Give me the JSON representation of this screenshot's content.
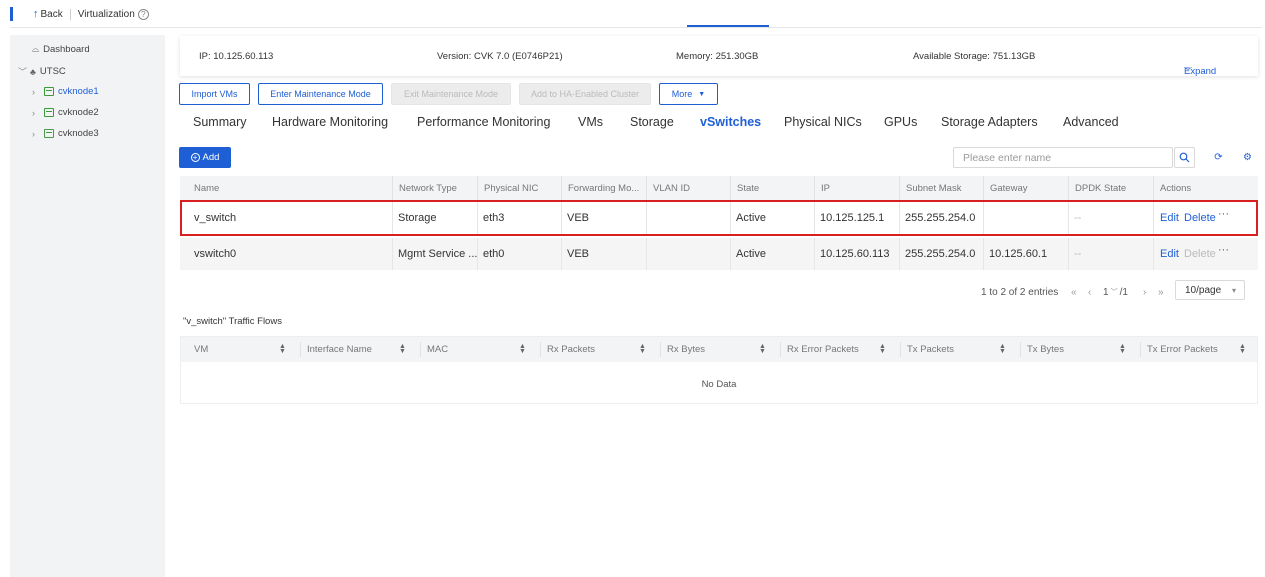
{
  "topbar": {
    "back_label": "Back",
    "title": "Virtualization"
  },
  "sidebar": {
    "dashboard": "Dashboard",
    "cluster": "UTSC",
    "nodes": [
      "cvknode1",
      "cvknode2",
      "cvknode3"
    ]
  },
  "info": {
    "ip": "IP: 10.125.60.113",
    "version": "Version: CVK 7.0 (E0746P21)",
    "memory": "Memory: 251.30GB",
    "storage": "Available Storage: 751.13GB",
    "expand": "Expand"
  },
  "actions": {
    "import_vms": "Import VMs",
    "enter_maintenance": "Enter Maintenance Mode",
    "exit_maintenance": "Exit Maintenance Mode",
    "add_ha": "Add to HA-Enabled Cluster",
    "more": "More"
  },
  "tabs": [
    "Summary",
    "Hardware Monitoring",
    "Performance Monitoring",
    "VMs",
    "Storage",
    "vSwitches",
    "Physical NICs",
    "GPUs",
    "Storage Adapters",
    "Advanced"
  ],
  "active_tab": "vSwitches",
  "toolbar": {
    "add_label": "Add",
    "search_placeholder": "Please enter name"
  },
  "vswitch_table": {
    "headers": [
      "Name",
      "Network Type",
      "Physical NIC",
      "Forwarding Mo...",
      "VLAN ID",
      "State",
      "IP",
      "Subnet Mask",
      "Gateway",
      "DPDK State",
      "Actions"
    ],
    "rows": [
      {
        "name": "v_switch",
        "network_type": "Storage",
        "nic": "eth3",
        "forwarding": "VEB",
        "vlan": "",
        "state": "Active",
        "ip": "10.125.125.1",
        "mask": "255.255.254.0",
        "gateway": "",
        "dpdk": "--",
        "edit": "Edit",
        "delete": "Delete",
        "more": "···"
      },
      {
        "name": "vswitch0",
        "network_type": "Mgmt Service ...",
        "nic": "eth0",
        "forwarding": "VEB",
        "vlan": "",
        "state": "Active",
        "ip": "10.125.60.113",
        "mask": "255.255.254.0",
        "gateway": "10.125.60.1",
        "dpdk": "--",
        "edit": "Edit",
        "delete": "Delete",
        "more": "···"
      }
    ]
  },
  "pagination": {
    "summary": "1 to 2 of 2 entries",
    "page": "1",
    "pages": "/1",
    "page_size": "10/page"
  },
  "flows": {
    "title": "\"v_switch\"  Traffic Flows",
    "headers": [
      "VM",
      "Interface Name",
      "MAC",
      "Rx Packets",
      "Rx Bytes",
      "Rx Error Packets",
      "Tx Packets",
      "Tx Bytes",
      "Tx Error Packets"
    ],
    "empty": "No Data"
  },
  "colors": {
    "accent": "#1f5fd6",
    "highlight": "#d82020"
  }
}
